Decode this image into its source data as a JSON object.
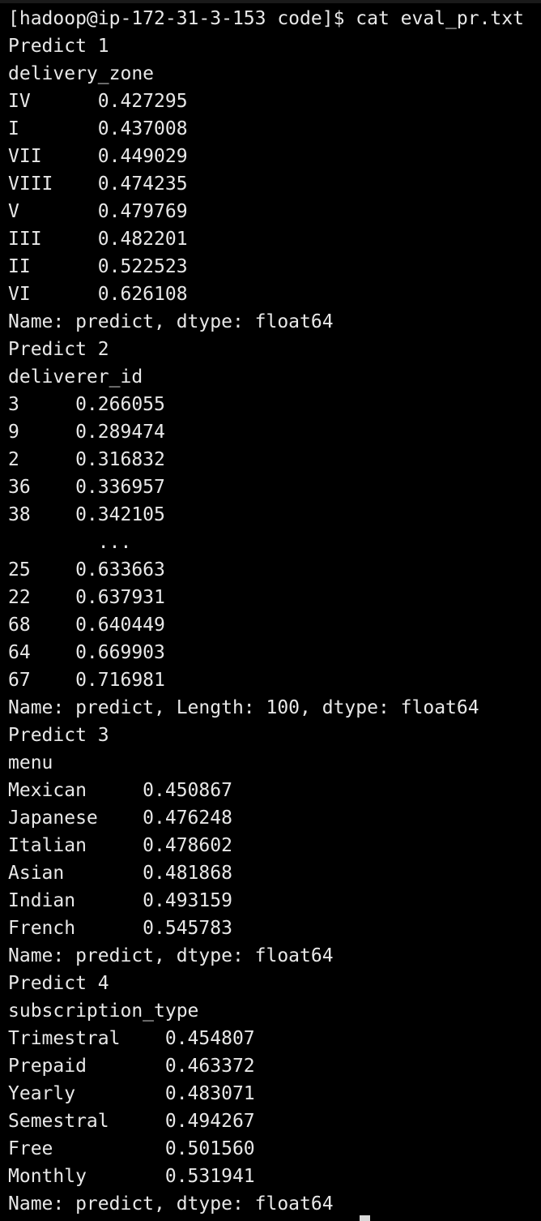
{
  "terminal": {
    "prompt": "[hadoop@ip-172-31-3-153 code]$ cat eval_pr.txt",
    "lines": [
      "Predict 1",
      "delivery_zone",
      "IV      0.427295",
      "I       0.437008",
      "VII     0.449029",
      "VIII    0.474235",
      "V       0.479769",
      "III     0.482201",
      "II      0.522523",
      "VI      0.626108",
      "Name: predict, dtype: float64",
      "Predict 2",
      "deliverer_id",
      "3     0.266055",
      "9     0.289474",
      "2     0.316832",
      "36    0.336957",
      "38    0.342105",
      "        ...",
      "25    0.633663",
      "22    0.637931",
      "68    0.640449",
      "64    0.669903",
      "67    0.716981",
      "Name: predict, Length: 100, dtype: float64",
      "Predict 3",
      "menu",
      "Mexican     0.450867",
      "Japanese    0.476248",
      "Italian     0.478602",
      "Asian       0.481868",
      "Indian      0.493159",
      "French      0.545783",
      "Name: predict, dtype: float64",
      "Predict 4",
      "subscription_type",
      "Trimestral    0.454807",
      "Prepaid       0.463372",
      "Yearly        0.483071",
      "Semestral     0.494267",
      "Free          0.501560",
      "Monthly       0.531941",
      "Name: predict, dtype: float64"
    ]
  },
  "colors": {
    "background": "#000000",
    "text": "#e8e8e8",
    "cursor": "#d9d9d9"
  }
}
